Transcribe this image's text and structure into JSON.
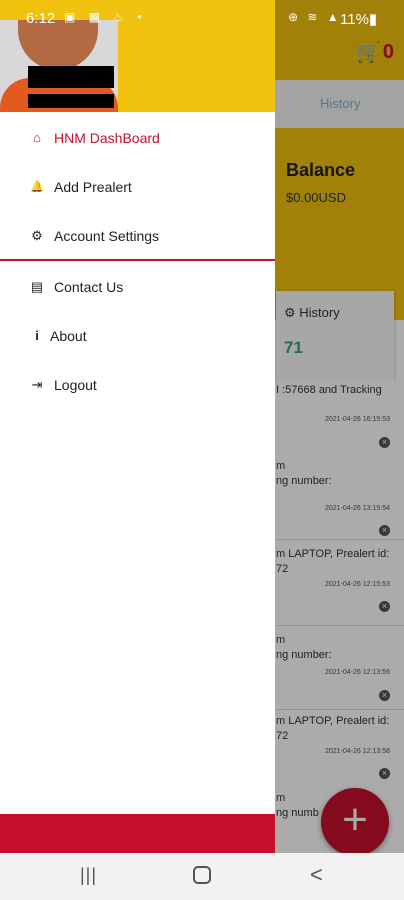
{
  "status_bar": {
    "time": "6:12",
    "left_icons": "▣ ▩ ♨ •",
    "right_icons": "⊕ ≋ ▲",
    "battery": "11%▮"
  },
  "background_app": {
    "cart_count": "0",
    "tab_history": "History",
    "balance_title": "Balance",
    "balance_value": "$0.00USD",
    "history_card_title": "History",
    "history_count": "71",
    "feed": [
      {
        "text": "I :57668 and Tracking",
        "date": "2021-04-26 16:15:53"
      },
      {
        "text": "m\nng number:",
        "date": "2021-04-26 13:15:54"
      },
      {
        "text": "m LAPTOP, Prealert id:\n72",
        "date": "2021-04-26 12:15:53"
      },
      {
        "text": "m\nng number:",
        "date": "2021-04-26 12:13:56"
      },
      {
        "text": "m LAPTOP, Prealert id:\n72",
        "date": "2021-04-26 12:13:58"
      },
      {
        "text": "m\nng numb",
        "date": ""
      }
    ],
    "fab_label": "+"
  },
  "drawer": {
    "menu": [
      {
        "label": "HNM DashBoard",
        "icon": "home-icon",
        "glyph": "⌂"
      },
      {
        "label": "Add Prealert",
        "icon": "bell-icon",
        "glyph": "🔔"
      },
      {
        "label": "Account Settings",
        "icon": "gear-icon",
        "glyph": "⚙"
      },
      {
        "label": "Contact Us",
        "icon": "contact-card-icon",
        "glyph": "▤"
      },
      {
        "label": "About",
        "icon": "info-icon",
        "glyph": "i"
      },
      {
        "label": "Logout",
        "icon": "logout-icon",
        "glyph": "⇥"
      }
    ]
  },
  "nav_bar": {
    "recent": "|||",
    "back": "<"
  },
  "colors": {
    "brand_yellow": "#f0c10d",
    "brand_red": "#c8102e"
  }
}
